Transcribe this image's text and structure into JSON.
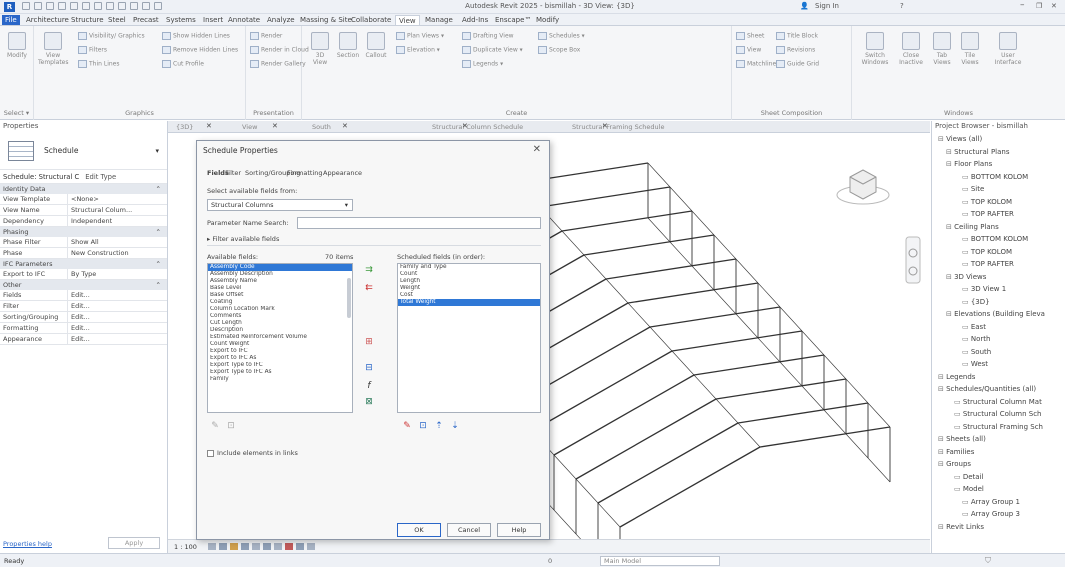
{
  "app": {
    "title": "Autodesk Revit 2025 - bismillah - 3D View: {3D}",
    "user_label": "Sign In",
    "help_label": "?"
  },
  "tabs": [
    "File",
    "Architecture",
    "Structure",
    "Steel",
    "Precast",
    "Systems",
    "Insert",
    "Annotate",
    "Analyze",
    "Massing & Site",
    "Collaborate",
    "View",
    "Manage",
    "Add-Ins",
    "Enscape™",
    "Modify"
  ],
  "active_tab": "View",
  "ribbon": {
    "select": {
      "modify": "Modify",
      "caption": "Select ▾"
    },
    "graphics": {
      "caption": "Graphics",
      "view_templates": "View Templates",
      "visibility": "Visibility/ Graphics",
      "filters": "Filters",
      "thin_lines": "Thin Lines",
      "show_hidden": "Show Hidden Lines",
      "remove_hidden": "Remove Hidden Lines",
      "cut_profile": "Cut Profile"
    },
    "presentation": {
      "caption": "Presentation",
      "render": "Render",
      "render_cloud": "Render in Cloud",
      "render_gallery": "Render Gallery"
    },
    "create": {
      "caption": "Create",
      "view3d": "3D View",
      "section": "Section",
      "callout": "Callout",
      "plan_views": "Plan Views ▾",
      "drafting": "Drafting View",
      "schedules": "Schedules ▾",
      "elevation": "Elevation ▾",
      "duplicate": "Duplicate View ▾",
      "scope_box": "Scope Box",
      "legends": "Legends ▾"
    },
    "sheet": {
      "caption": "Sheet Composition",
      "sheet": "Sheet",
      "title_block": "Title Block",
      "view": "View",
      "revisions": "Revisions",
      "guide_grid": "Guide Grid",
      "matchline": "Matchline"
    },
    "windows": {
      "caption": "Windows",
      "switch": "Switch Windows",
      "close": "Close Inactive",
      "tab": "Tab Views",
      "tile": "Tile Views",
      "ui": "User Interface"
    }
  },
  "properties": {
    "title": "Properties",
    "type_name": "Schedule",
    "selector": "Schedule: Structural C",
    "edit_type": "Edit Type",
    "sections": [
      {
        "name": "Identity Data",
        "rows": [
          [
            "View Template",
            "<None>"
          ],
          [
            "View Name",
            "Structural Colum..."
          ],
          [
            "Dependency",
            "Independent"
          ]
        ]
      },
      {
        "name": "Phasing",
        "rows": [
          [
            "Phase Filter",
            "Show All"
          ],
          [
            "Phase",
            "New Construction"
          ]
        ]
      },
      {
        "name": "IFC Parameters",
        "rows": [
          [
            "Export to IFC",
            "By Type"
          ]
        ]
      },
      {
        "name": "Other",
        "rows": [
          [
            "Fields",
            "Edit..."
          ],
          [
            "Filter",
            "Edit..."
          ],
          [
            "Sorting/Grouping",
            "Edit..."
          ],
          [
            "Formatting",
            "Edit..."
          ],
          [
            "Appearance",
            "Edit..."
          ]
        ]
      }
    ],
    "help": "Properties help",
    "apply": "Apply"
  },
  "view_tabs": [
    "{3D}",
    "View",
    "South",
    "Structural Column Schedule",
    "Structural Framing Schedule"
  ],
  "dialog": {
    "title": "Schedule Properties",
    "close": "✕",
    "tabs": [
      "Fields",
      "Filter",
      "Sorting/Grouping",
      "Formatting",
      "Appearance"
    ],
    "select_label": "Select available fields from:",
    "select_value": "Structural Columns",
    "search_label": "Parameter Name Search:",
    "filter_label": "Filter available fields",
    "available_label": "Available fields:",
    "available_count": "70 items",
    "available": [
      "Assembly Code",
      "Assembly Description",
      "Assembly Name",
      "Base Level",
      "Base Offset",
      "Coating",
      "Column Location Mark",
      "Comments",
      "Cut Length",
      "Description",
      "Estimated Reinforcement Volume",
      "Count Weight",
      "Export to IFC",
      "Export to IFC As",
      "Export Type to IFC",
      "Export Type to IFC As",
      "Family"
    ],
    "scheduled_label": "Scheduled fields (in order):",
    "scheduled": [
      "Family and Type",
      "Count",
      "Length",
      "Weight",
      "Cost",
      "Total Weight"
    ],
    "selected_scheduled": "Total Weight",
    "include_links": "Include elements in links",
    "ok": "OK",
    "cancel": "Cancel",
    "help": "Help"
  },
  "browser": {
    "title": "Project Browser - bismillah",
    "items": [
      {
        "t": "Views (all)",
        "d": 0
      },
      {
        "t": "Structural Plans",
        "d": 1
      },
      {
        "t": "Floor Plans",
        "d": 1
      },
      {
        "t": "BOTTOM KOLOM",
        "d": 3
      },
      {
        "t": "Site",
        "d": 3
      },
      {
        "t": "TOP KOLOM",
        "d": 3
      },
      {
        "t": "TOP RAFTER",
        "d": 3
      },
      {
        "t": "Ceiling Plans",
        "d": 1
      },
      {
        "t": "BOTTOM KOLOM",
        "d": 3
      },
      {
        "t": "TOP KOLOM",
        "d": 3
      },
      {
        "t": "TOP RAFTER",
        "d": 3
      },
      {
        "t": "3D Views",
        "d": 1
      },
      {
        "t": "3D View 1",
        "d": 3
      },
      {
        "t": "{3D}",
        "d": 3
      },
      {
        "t": "Elevations (Building Eleva",
        "d": 1
      },
      {
        "t": "East",
        "d": 3
      },
      {
        "t": "North",
        "d": 3
      },
      {
        "t": "South",
        "d": 3
      },
      {
        "t": "West",
        "d": 3
      },
      {
        "t": "Legends",
        "d": 0
      },
      {
        "t": "Schedules/Quantities (all)",
        "d": 0
      },
      {
        "t": "Structural Column Mat",
        "d": 2
      },
      {
        "t": "Structural Column Sch",
        "d": 2
      },
      {
        "t": "Structural Framing Sch",
        "d": 2
      },
      {
        "t": "Sheets (all)",
        "d": 0
      },
      {
        "t": "Families",
        "d": 0
      },
      {
        "t": "Groups",
        "d": 0
      },
      {
        "t": "Detail",
        "d": 2
      },
      {
        "t": "Model",
        "d": 2
      },
      {
        "t": "Array Group 1",
        "d": 3
      },
      {
        "t": "Array Group 3",
        "d": 3
      },
      {
        "t": "Revit Links",
        "d": 0
      }
    ]
  },
  "viewbar": {
    "scale": "1 : 100"
  },
  "status": {
    "text": "Ready",
    "model": "Main Model",
    "coord": "0"
  },
  "colors": {
    "accent": "#2a66c8",
    "selection": "#2f78d6"
  }
}
